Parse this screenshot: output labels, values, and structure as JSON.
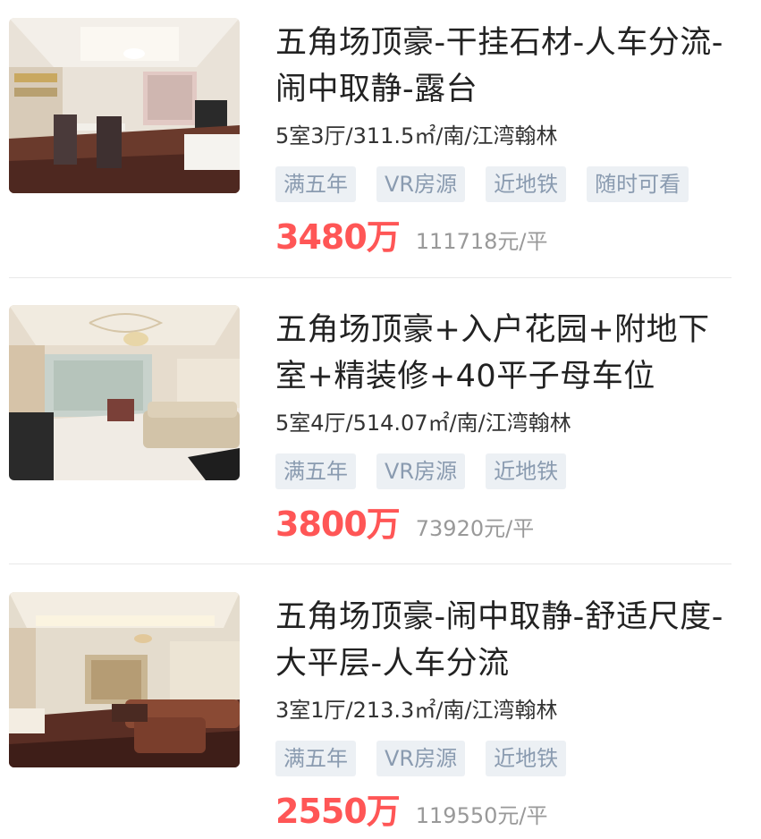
{
  "listings": [
    {
      "title": "五角场顶豪-干挂石材-人车分流-闹中取静-露台",
      "meta": "5室3厅/311.5㎡/南/江湾翰林",
      "tags": [
        "满五年",
        "VR房源",
        "近地铁",
        "随时可看"
      ],
      "price": "3480万",
      "unit_price": "111718元/平"
    },
    {
      "title": "五角场顶豪+入户花园+附地下室+精装修+40平子母车位",
      "meta": "5室4厅/514.07㎡/南/江湾翰林",
      "tags": [
        "满五年",
        "VR房源",
        "近地铁"
      ],
      "price": "3800万",
      "unit_price": "73920元/平"
    },
    {
      "title": "五角场顶豪-闹中取静-舒适尺度-大平层-人车分流",
      "meta": "3室1厅/213.3㎡/南/江湾翰林",
      "tags": [
        "满五年",
        "VR房源",
        "近地铁"
      ],
      "price": "2550万",
      "unit_price": "119550元/平"
    }
  ],
  "colors": {
    "price": "#ff5656",
    "tag_bg": "#ecf0f4",
    "tag_text": "#8a9bb0",
    "unit_price": "#999999"
  }
}
